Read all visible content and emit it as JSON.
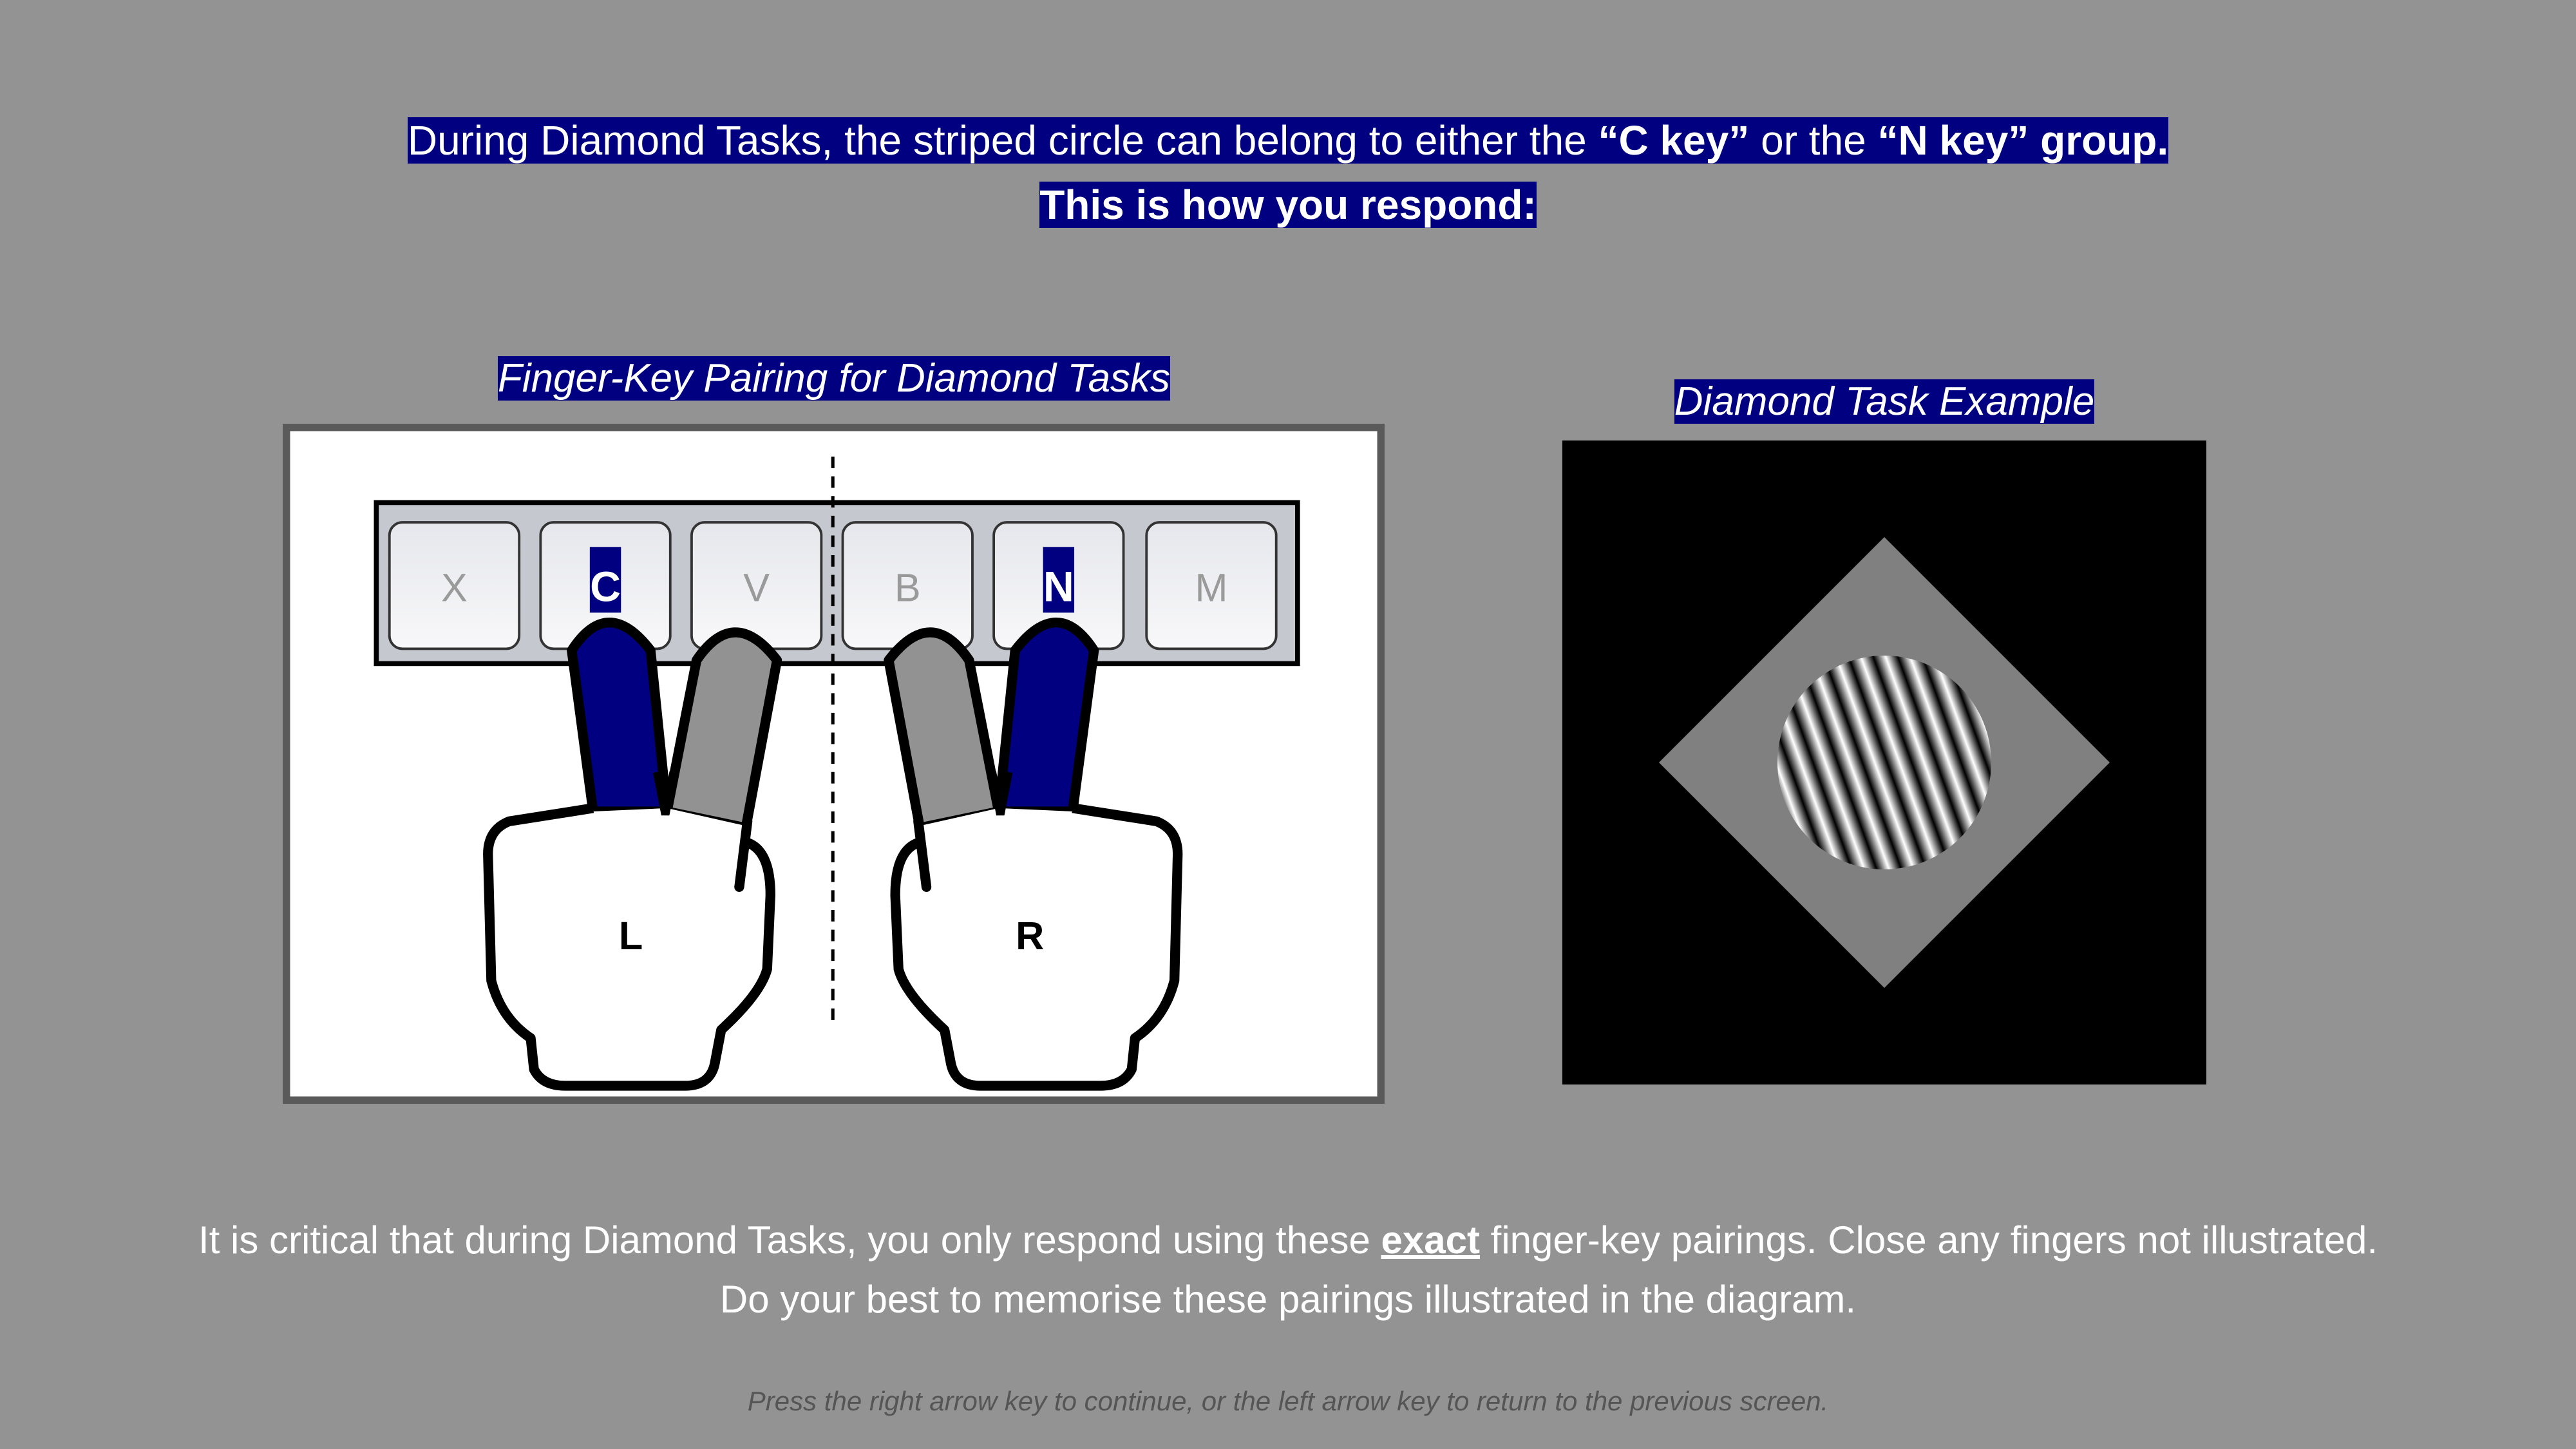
{
  "colors": {
    "background": "#939393",
    "highlight": "#000080",
    "finger_active": "#000080",
    "finger_inactive": "#929292",
    "footer_text": "#555555"
  },
  "title": {
    "line1_a": "During Diamond Tasks, the striped circle can belong to either the ",
    "line1_b": "“C key”",
    "line1_c": " or the ",
    "line1_d": "“N key” group.",
    "line2": "This is how you respond:"
  },
  "left_panel": {
    "caption": "Finger-Key Pairing for Diamond Tasks",
    "keys": [
      "X",
      "C",
      "V",
      "B",
      "N",
      "M"
    ],
    "highlighted_keys": [
      "C",
      "N"
    ],
    "left_hand_label": "L",
    "right_hand_label": "R"
  },
  "right_panel": {
    "caption": "Diamond Task Example"
  },
  "instructions": {
    "line1_a": "It is critical that during Diamond Tasks, you only respond using these ",
    "line1_b": "exact",
    "line1_c": " finger-key pairings. Close any fingers not illustrated.",
    "line2": "Do your best to memorise these pairings illustrated in the diagram."
  },
  "footer": "Press the right arrow key to continue, or the left arrow key to return to the previous screen."
}
